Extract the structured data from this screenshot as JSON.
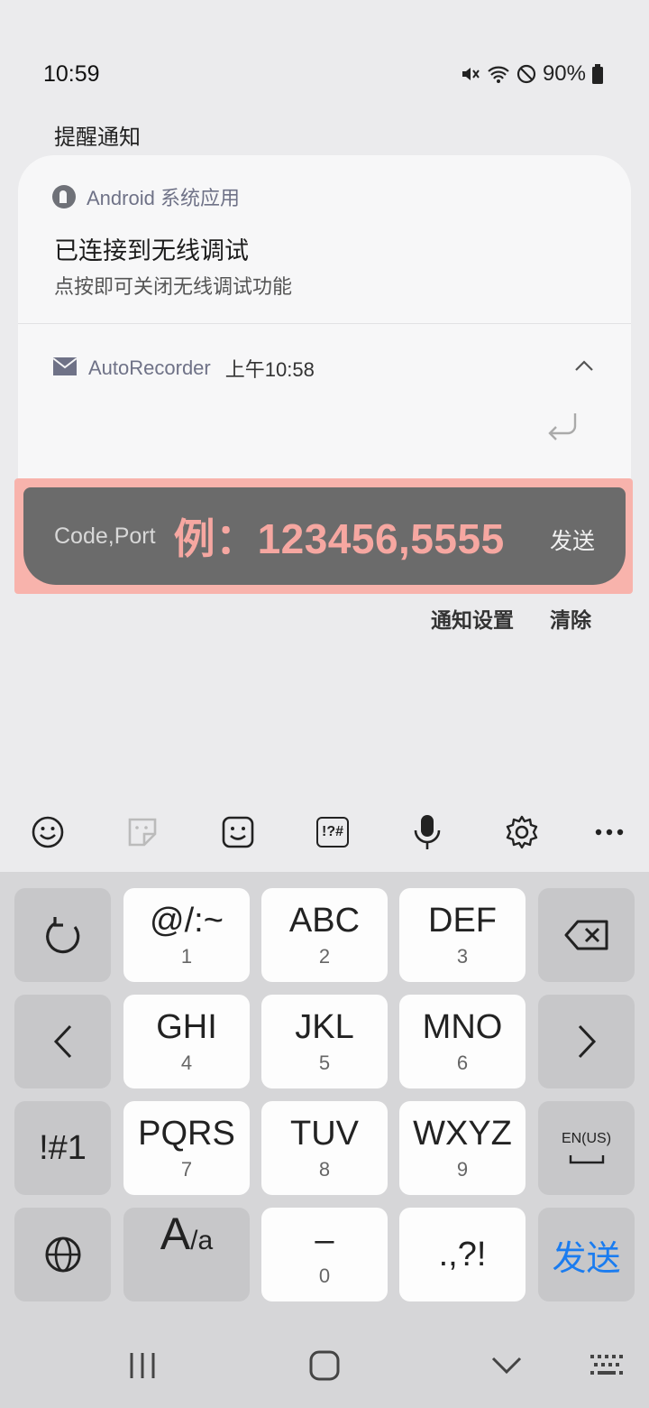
{
  "status_bar": {
    "time": "10:59",
    "battery": "90%",
    "icons": [
      "mute-icon",
      "wifi-icon",
      "dnd-icon",
      "battery-icon"
    ]
  },
  "section_title": "提醒通知",
  "notifications": [
    {
      "app_name": "Android 系统应用",
      "title": "已连接到无线调试",
      "text": "点按即可关闭无线调试功能"
    },
    {
      "app_name": "AutoRecorder",
      "time": "上午10:58"
    }
  ],
  "reply": {
    "label": "Code,Port",
    "placeholder": "例：123456,5555",
    "send_label": "发送"
  },
  "notification_actions": {
    "settings": "通知设置",
    "clear": "清除"
  },
  "keyboard": {
    "toolbar_icons": [
      "emoji-icon",
      "sticker-icon",
      "bitmoji-icon",
      "symbols-icon",
      "mic-icon",
      "settings-icon",
      "more-icon"
    ],
    "symbols_label": "!?#",
    "keys": {
      "k1_main": "@/:~",
      "k1_sub": "1",
      "k2_main": "ABC",
      "k2_sub": "2",
      "k3_main": "DEF",
      "k3_sub": "3",
      "k4_main": "GHI",
      "k4_sub": "4",
      "k5_main": "JKL",
      "k5_sub": "5",
      "k6_main": "MNO",
      "k6_sub": "6",
      "k7_main": "PQRS",
      "k7_sub": "7",
      "k8_main": "TUV",
      "k8_sub": "8",
      "k9_main": "WXYZ",
      "k9_sub": "9",
      "k0_main": "–",
      "k0_sub": "0",
      "punct": ".,?!",
      "sym": "!#1",
      "lang": "EN(US)",
      "case_big": "A",
      "case_small": "/a",
      "send": "发送"
    }
  },
  "colors": {
    "accent_send": "#1a7cf0",
    "highlight": "#f8b3ac",
    "placeholder": "#f6a7a1"
  }
}
